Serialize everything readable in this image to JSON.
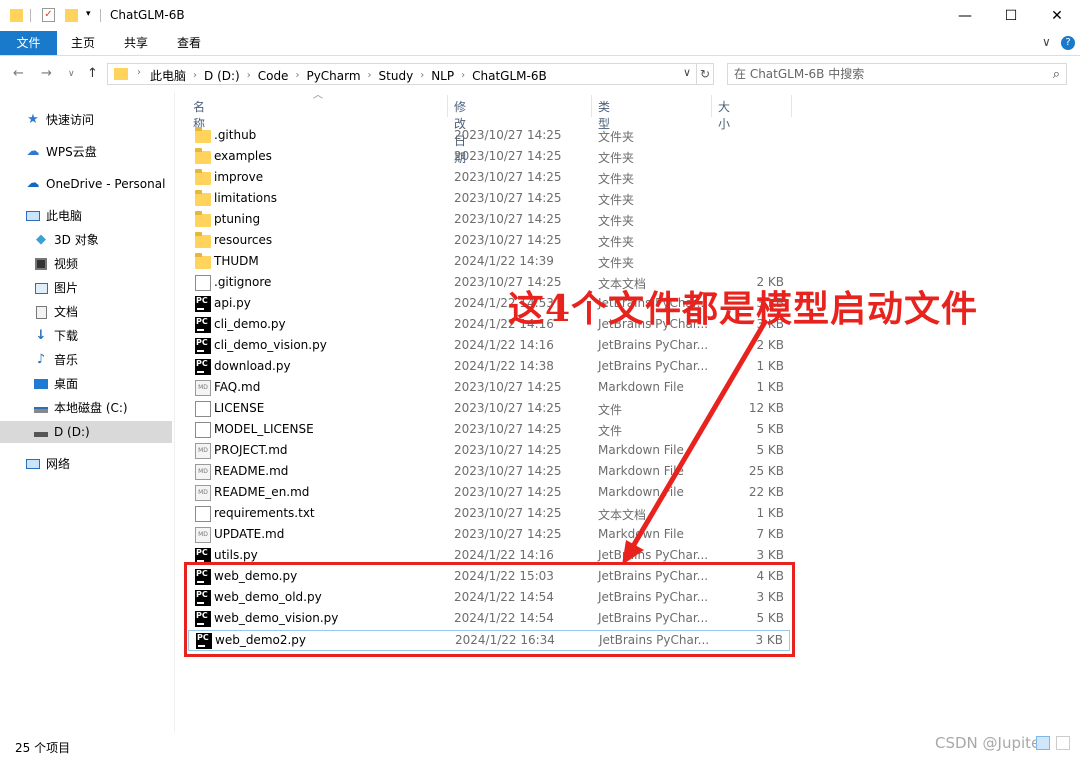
{
  "window": {
    "title": "ChatGLM-6B",
    "minimize_glyph": "—",
    "maximize_glyph": "☐",
    "close_glyph": "✕"
  },
  "ribbon": {
    "tabs": [
      "文件",
      "主页",
      "共享",
      "查看"
    ],
    "expand_glyph": "∨",
    "help_glyph": "?"
  },
  "address": {
    "crumbs": [
      "此电脑",
      "D (D:)",
      "Code",
      "PyCharm",
      "Study",
      "NLP",
      "ChatGLM-6B"
    ],
    "search_placeholder": "在 ChatGLM-6B 中搜索"
  },
  "nav_pane": {
    "items": [
      {
        "label": "快速访问",
        "icon": "star-icon"
      },
      {
        "label": "WPS云盘",
        "icon": "cloud-icon"
      },
      {
        "label": "OneDrive - Personal",
        "icon": "onedrive-icon"
      },
      {
        "label": "此电脑",
        "icon": "computer-icon"
      },
      {
        "label": "3D 对象",
        "icon": "cube-icon"
      },
      {
        "label": "视频",
        "icon": "video-icon"
      },
      {
        "label": "图片",
        "icon": "picture-icon"
      },
      {
        "label": "文档",
        "icon": "document-icon"
      },
      {
        "label": "下载",
        "icon": "download-icon"
      },
      {
        "label": "音乐",
        "icon": "music-icon"
      },
      {
        "label": "桌面",
        "icon": "desktop-icon"
      },
      {
        "label": "本地磁盘 (C:)",
        "icon": "disk-icon"
      },
      {
        "label": "D (D:)",
        "icon": "drive-icon"
      },
      {
        "label": "网络",
        "icon": "network-icon"
      }
    ]
  },
  "columns": {
    "name": "名称",
    "date": "修改日期",
    "type": "类型",
    "size": "大小"
  },
  "files": [
    {
      "name": ".github",
      "date": "2023/10/27 14:25",
      "type": "文件夹",
      "size": "",
      "icon": "folder-icon"
    },
    {
      "name": "examples",
      "date": "2023/10/27 14:25",
      "type": "文件夹",
      "size": "",
      "icon": "folder-icon"
    },
    {
      "name": "improve",
      "date": "2023/10/27 14:25",
      "type": "文件夹",
      "size": "",
      "icon": "folder-icon"
    },
    {
      "name": "limitations",
      "date": "2023/10/27 14:25",
      "type": "文件夹",
      "size": "",
      "icon": "folder-icon"
    },
    {
      "name": "ptuning",
      "date": "2023/10/27 14:25",
      "type": "文件夹",
      "size": "",
      "icon": "folder-icon"
    },
    {
      "name": "resources",
      "date": "2023/10/27 14:25",
      "type": "文件夹",
      "size": "",
      "icon": "folder-icon"
    },
    {
      "name": "THUDM",
      "date": "2024/1/22 14:39",
      "type": "文件夹",
      "size": "",
      "icon": "folder-icon"
    },
    {
      "name": ".gitignore",
      "date": "2023/10/27 14:25",
      "type": "文本文档",
      "size": "2 KB",
      "icon": "text-file-icon"
    },
    {
      "name": "api.py",
      "date": "2024/1/22 14:53",
      "type": "JetBrains PyChar...",
      "size": "3 KB",
      "icon": "pycharm-file-icon"
    },
    {
      "name": "cli_demo.py",
      "date": "2024/1/22 14:16",
      "type": "JetBrains PyChar...",
      "size": "3 KB",
      "icon": "pycharm-file-icon"
    },
    {
      "name": "cli_demo_vision.py",
      "date": "2024/1/22 14:16",
      "type": "JetBrains PyChar...",
      "size": "2 KB",
      "icon": "pycharm-file-icon"
    },
    {
      "name": "download.py",
      "date": "2024/1/22 14:38",
      "type": "JetBrains PyChar...",
      "size": "1 KB",
      "icon": "pycharm-file-icon"
    },
    {
      "name": "FAQ.md",
      "date": "2023/10/27 14:25",
      "type": "Markdown File",
      "size": "1 KB",
      "icon": "markdown-file-icon"
    },
    {
      "name": "LICENSE",
      "date": "2023/10/27 14:25",
      "type": "文件",
      "size": "12 KB",
      "icon": "blank-file-icon"
    },
    {
      "name": "MODEL_LICENSE",
      "date": "2023/10/27 14:25",
      "type": "文件",
      "size": "5 KB",
      "icon": "blank-file-icon"
    },
    {
      "name": "PROJECT.md",
      "date": "2023/10/27 14:25",
      "type": "Markdown File",
      "size": "5 KB",
      "icon": "markdown-file-icon"
    },
    {
      "name": "README.md",
      "date": "2023/10/27 14:25",
      "type": "Markdown File",
      "size": "25 KB",
      "icon": "markdown-file-icon"
    },
    {
      "name": "README_en.md",
      "date": "2023/10/27 14:25",
      "type": "Markdown File",
      "size": "22 KB",
      "icon": "markdown-file-icon"
    },
    {
      "name": "requirements.txt",
      "date": "2023/10/27 14:25",
      "type": "文本文档",
      "size": "1 KB",
      "icon": "text-file-icon"
    },
    {
      "name": "UPDATE.md",
      "date": "2023/10/27 14:25",
      "type": "Markdown File",
      "size": "7 KB",
      "icon": "markdown-file-icon"
    },
    {
      "name": "utils.py",
      "date": "2024/1/22 14:16",
      "type": "JetBrains PyChar...",
      "size": "3 KB",
      "icon": "pycharm-file-icon"
    },
    {
      "name": "web_demo.py",
      "date": "2024/1/22 15:03",
      "type": "JetBrains PyChar...",
      "size": "4 KB",
      "icon": "pycharm-file-icon"
    },
    {
      "name": "web_demo_old.py",
      "date": "2024/1/22 14:54",
      "type": "JetBrains PyChar...",
      "size": "3 KB",
      "icon": "pycharm-file-icon"
    },
    {
      "name": "web_demo_vision.py",
      "date": "2024/1/22 14:54",
      "type": "JetBrains PyChar...",
      "size": "5 KB",
      "icon": "pycharm-file-icon"
    },
    {
      "name": "web_demo2.py",
      "date": "2024/1/22 16:34",
      "type": "JetBrains PyChar...",
      "size": "3 KB",
      "icon": "pycharm-file-icon"
    }
  ],
  "annotation": {
    "text": "这4个文件都是模型启动文件",
    "color": "#e8221d"
  },
  "status": {
    "item_count": "25 个项目"
  },
  "watermark": "CSDN @Jupiter",
  "colors": {
    "accent": "#1979ca",
    "selected": "#d9d9d9",
    "folder": "#ffd35c"
  }
}
